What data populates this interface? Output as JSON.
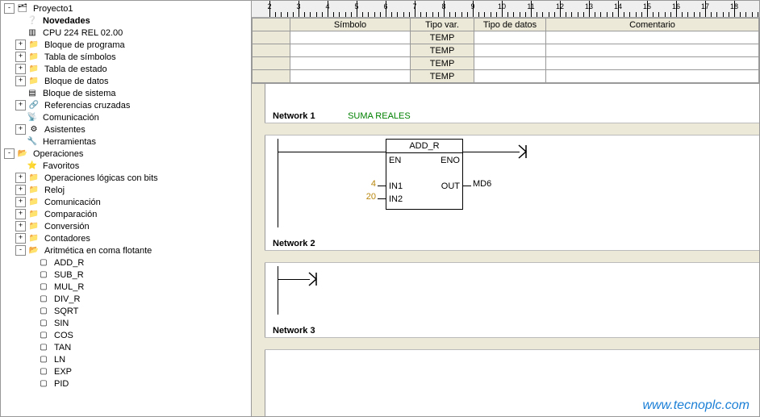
{
  "tree": {
    "proyecto": "Proyecto1",
    "novedades": "Novedades",
    "cpu": "CPU 224 REL 02.00",
    "bloque_programa": "Bloque de programa",
    "tabla_simbolos": "Tabla de símbolos",
    "tabla_estado": "Tabla de estado",
    "bloque_datos": "Bloque de datos",
    "bloque_sistema": "Bloque de sistema",
    "ref_cruzadas": "Referencias cruzadas",
    "comunicacion": "Comunicación",
    "asistentes": "Asistentes",
    "herramientas": "Herramientas",
    "operaciones": "Operaciones",
    "favoritos": "Favoritos",
    "op_logicas": "Operaciones lógicas con bits",
    "reloj": "Reloj",
    "comunicacion2": "Comunicación",
    "comparacion": "Comparación",
    "conversion": "Conversión",
    "contadores": "Contadores",
    "arit_coma": "Aritmética en coma flotante",
    "add_r": "ADD_R",
    "sub_r": "SUB_R",
    "mul_r": "MUL_R",
    "div_r": "DIV_R",
    "sqrt": "SQRT",
    "sin": "SIN",
    "cos": "COS",
    "tan": "TAN",
    "ln": "LN",
    "exp": "EXP",
    "pid": "PID"
  },
  "var_table": {
    "headers": {
      "simbolo": "Símbolo",
      "tipo_var": "Tipo var.",
      "tipo_datos": "Tipo de datos",
      "comentario": "Comentario"
    },
    "rows": [
      {
        "tipo_var": "TEMP"
      },
      {
        "tipo_var": "TEMP"
      },
      {
        "tipo_var": "TEMP"
      },
      {
        "tipo_var": "TEMP"
      }
    ]
  },
  "ruler": {
    "from": 2,
    "to": 18
  },
  "networks": {
    "n1": {
      "label": "Network 1",
      "title": "SUMA REALES"
    },
    "n2": {
      "label": "Network 2",
      "title": ""
    },
    "n3": {
      "label": "Network 3",
      "title": ""
    }
  },
  "block": {
    "name": "ADD_R",
    "ports": {
      "en": "EN",
      "eno": "ENO",
      "in1": "IN1",
      "in2": "IN2",
      "out": "OUT"
    },
    "in1_val": "4",
    "in2_val": "20",
    "out_var": "MD6"
  },
  "watermark": "www.tecnoplc.com"
}
